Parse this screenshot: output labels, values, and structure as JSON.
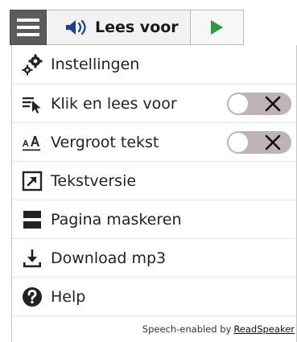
{
  "toolbar": {
    "menu_icon": "hamburger-icon",
    "listen_icon": "speaker-icon",
    "listen_label": "Lees voor",
    "play_icon": "play-icon",
    "play_color": "#2e9a3c"
  },
  "menu": {
    "items": [
      {
        "label": "Instellingen",
        "icon": "settings-gears-icon",
        "toggle": null
      },
      {
        "label": "Klik en lees voor",
        "icon": "click-and-read-icon",
        "toggle": "off"
      },
      {
        "label": "Vergroot tekst",
        "icon": "enlarge-text-icon",
        "toggle": "off"
      },
      {
        "label": "Tekstversie",
        "icon": "text-version-icon",
        "toggle": null
      },
      {
        "label": "Pagina maskeren",
        "icon": "page-mask-icon",
        "toggle": null
      },
      {
        "label": "Download mp3",
        "icon": "download-icon",
        "toggle": null
      },
      {
        "label": "Help",
        "icon": "help-icon",
        "toggle": null
      }
    ]
  },
  "footer": {
    "prefix": "Speech-enabled by",
    "brand": "ReadSpeaker"
  },
  "colors": {
    "menu_toggle_bg": "#5b5b5b",
    "toggle_off_bg": "#bfb3b3",
    "icon_dark": "#222222"
  }
}
